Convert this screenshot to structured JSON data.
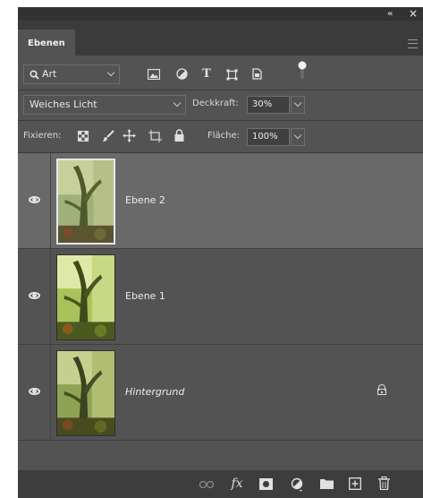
{
  "window": {
    "collapse_glyph": "«",
    "close_glyph": "×"
  },
  "tabs": [
    {
      "label": "Ebenen",
      "active": true
    }
  ],
  "filter": {
    "selected": "Art",
    "icons": [
      "image-filter-icon",
      "adjustment-filter-icon",
      "text-filter-icon",
      "shape-filter-icon",
      "smart-object-filter-icon",
      "filter-toggle-icon"
    ],
    "text_filter_glyph": "T"
  },
  "blend": {
    "mode": "Weiches Licht",
    "opacity_label": "Deckkraft:",
    "opacity_value": "30%"
  },
  "lock_row": {
    "label": "Fixieren:",
    "icons": [
      "lock-transparent-pixels-icon",
      "lock-image-pixels-icon",
      "lock-position-icon",
      "lock-artboard-icon",
      "lock-all-icon"
    ],
    "fill_label": "Fläche:",
    "fill_value": "100%"
  },
  "layers": [
    {
      "name": "Ebene 2",
      "selected": true,
      "italic": false,
      "locked": false,
      "visible": true
    },
    {
      "name": "Ebene 1",
      "selected": false,
      "italic": false,
      "locked": false,
      "visible": true
    },
    {
      "name": "Hintergrund",
      "selected": false,
      "italic": true,
      "locked": true,
      "visible": true
    }
  ],
  "bottom_bar": {
    "fx_label": "fx",
    "icons": [
      "link-layers-icon",
      "fx-icon",
      "add-mask-icon",
      "new-adjustment-layer-icon",
      "new-group-icon",
      "new-layer-icon",
      "delete-layer-icon"
    ]
  },
  "colors": {
    "panel": "#535353",
    "selected_layer": "#696969",
    "tabbar": "#3b3b3b",
    "text": "#ececec"
  }
}
